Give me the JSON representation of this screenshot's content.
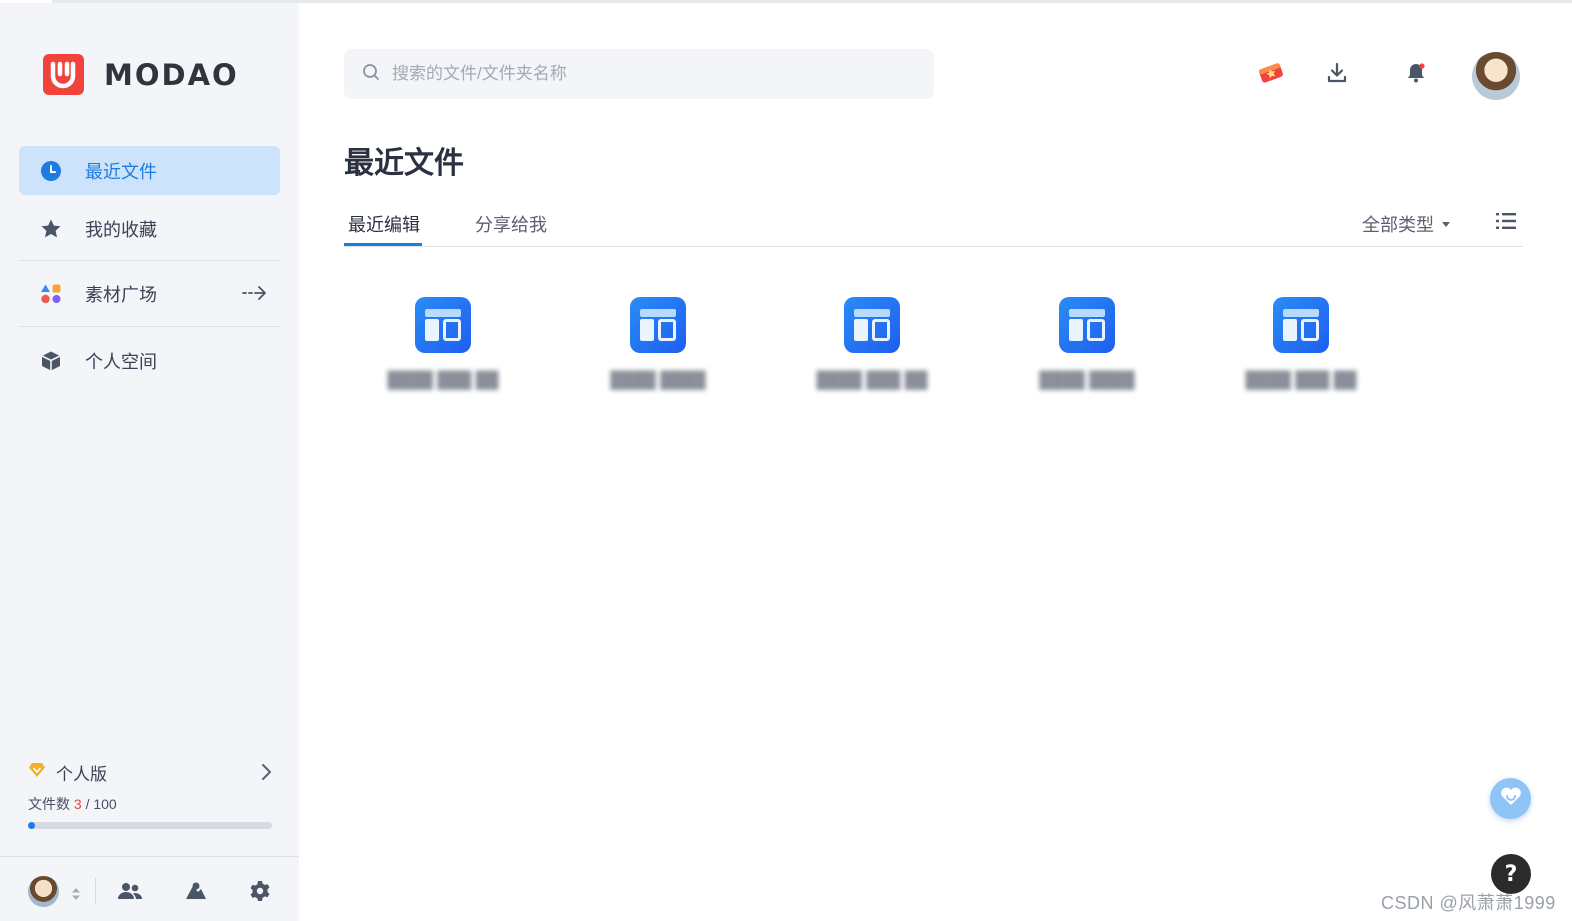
{
  "app": {
    "brand": "MODAO"
  },
  "sidebar": {
    "items": [
      {
        "label": "最近文件",
        "icon": "clock-icon",
        "active": true
      },
      {
        "label": "我的收藏",
        "icon": "star-icon",
        "active": false
      },
      {
        "label": "素材广场",
        "icon": "shapes-icon",
        "active": false
      },
      {
        "label": "个人空间",
        "icon": "cube-icon",
        "active": false
      }
    ],
    "plan": {
      "name": "个人版",
      "files_label": "文件数",
      "files_used": "3",
      "files_sep": " / ",
      "files_total": "100",
      "usage_fraction": 0.03
    },
    "bottom": {
      "icons": [
        "team-icon",
        "cloud-user-icon",
        "gear-icon"
      ]
    }
  },
  "search": {
    "placeholder": "搜索的文件/文件夹名称"
  },
  "header": {
    "icons": [
      "gift-ticket-icon",
      "download-icon",
      "bell-icon",
      "user-avatar"
    ]
  },
  "main": {
    "title": "最近文件",
    "tabs": [
      {
        "label": "最近编辑",
        "active": true
      },
      {
        "label": "分享给我",
        "active": false
      }
    ],
    "filter_label": "全部类型",
    "files": [
      {
        "name": "████ ███ ██"
      },
      {
        "name": "████ ████"
      },
      {
        "name": "████ ███ ██"
      },
      {
        "name": "████ ████"
      },
      {
        "name": "████ ███ ██"
      }
    ]
  },
  "watermark": "CSDN @风萧萧1999",
  "help_label": "?",
  "colors": {
    "accent": "#1e7ce0",
    "active_bg": "#cde3fb",
    "brand_red": "#f2423c",
    "sidebar_bg": "#f3f5f9"
  }
}
